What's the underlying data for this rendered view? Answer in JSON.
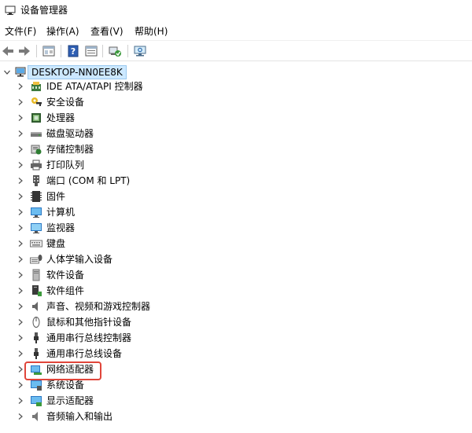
{
  "window": {
    "title": "设备管理器"
  },
  "menu": [
    {
      "label": "文件(F)"
    },
    {
      "label": "操作(A)"
    },
    {
      "label": "查看(V)"
    },
    {
      "label": "帮助(H)"
    }
  ],
  "toolbar": {
    "buttons": [
      {
        "icon": "back-arrow-icon"
      },
      {
        "icon": "forward-arrow-icon"
      },
      {
        "icon": "properties-panel-icon"
      },
      {
        "icon": "help-icon"
      },
      {
        "icon": "show-hidden-icon"
      },
      {
        "icon": "update-driver-icon"
      },
      {
        "icon": "scan-hardware-icon"
      }
    ]
  },
  "tree": {
    "root": {
      "label": "DESKTOP-NN0EE8K",
      "icon": "computer-icon",
      "expanded": true
    },
    "items": [
      {
        "label": "IDE ATA/ATAPI 控制器",
        "icon": "ide-controller-icon"
      },
      {
        "label": "安全设备",
        "icon": "security-device-icon"
      },
      {
        "label": "处理器",
        "icon": "processor-icon"
      },
      {
        "label": "磁盘驱动器",
        "icon": "disk-drive-icon"
      },
      {
        "label": "存储控制器",
        "icon": "storage-controller-icon"
      },
      {
        "label": "打印队列",
        "icon": "printer-icon"
      },
      {
        "label": "端口 (COM 和 LPT)",
        "icon": "port-icon"
      },
      {
        "label": "固件",
        "icon": "firmware-icon"
      },
      {
        "label": "计算机",
        "icon": "computer-monitor-icon"
      },
      {
        "label": "监视器",
        "icon": "monitor-icon"
      },
      {
        "label": "键盘",
        "icon": "keyboard-icon"
      },
      {
        "label": "人体学输入设备",
        "icon": "hid-icon"
      },
      {
        "label": "软件设备",
        "icon": "software-device-icon"
      },
      {
        "label": "软件组件",
        "icon": "software-component-icon"
      },
      {
        "label": "声音、视频和游戏控制器",
        "icon": "speaker-icon"
      },
      {
        "label": "鼠标和其他指针设备",
        "icon": "mouse-icon"
      },
      {
        "label": "通用串行总线控制器",
        "icon": "usb-icon"
      },
      {
        "label": "通用串行总线设备",
        "icon": "usb-icon"
      },
      {
        "label": "网络适配器",
        "icon": "network-adapter-icon",
        "highlighted": true
      },
      {
        "label": "系统设备",
        "icon": "system-device-icon"
      },
      {
        "label": "显示适配器",
        "icon": "display-adapter-icon"
      },
      {
        "label": "音频输入和输出",
        "icon": "audio-io-icon"
      }
    ]
  },
  "colors": {
    "highlight": "#e0453a",
    "selection": "#cce8ff",
    "selection_border": "#99c9ef"
  }
}
